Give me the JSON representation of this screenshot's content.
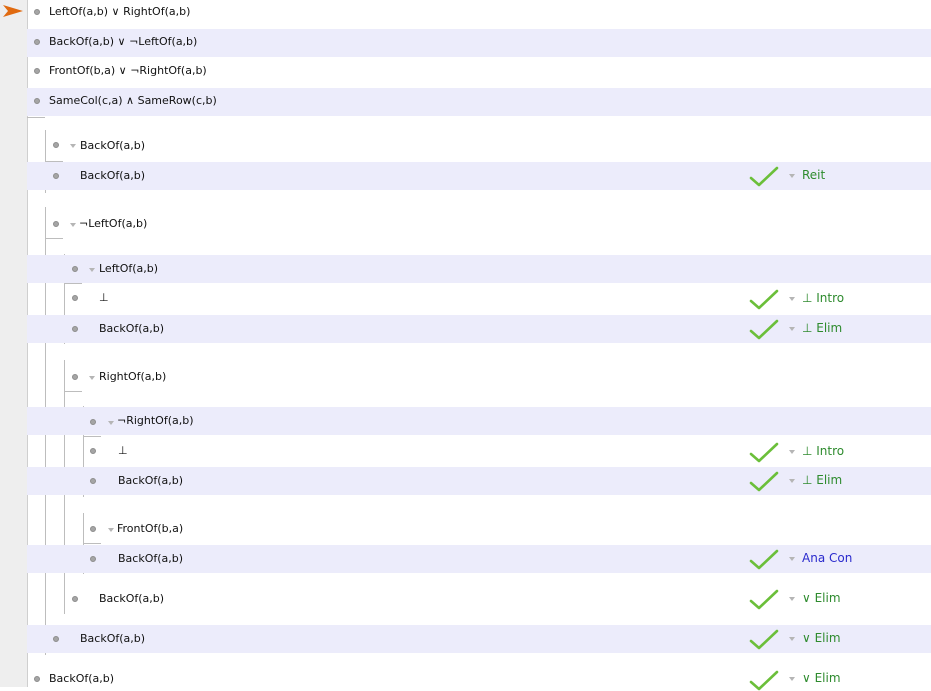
{
  "proof": {
    "premises": [
      "LeftOf(a,b) ∨ RightOf(a,b)",
      "BackOf(a,b) ∨ ¬LeftOf(a,b)",
      "FrontOf(b,a) ∨  ¬RightOf(a,b)",
      "SameCol(c,a) ∧ SameRow(c,b)"
    ],
    "sub1": {
      "assumption": "BackOf(a,b)",
      "step": "BackOf(a,b)",
      "rule": "Reit"
    },
    "sub2": {
      "assumption": "¬LeftOf(a,b)",
      "sub2a": {
        "assumption": "LeftOf(a,b)",
        "step1": "⊥",
        "rule1": "⊥ Intro",
        "step2": "BackOf(a,b)",
        "rule2": "⊥ Elim"
      },
      "sub2b": {
        "assumption": "RightOf(a,b)",
        "sub2b1": {
          "assumption": "¬RightOf(a,b)",
          "step1": "⊥",
          "rule1": "⊥ Intro",
          "step2": "BackOf(a,b)",
          "rule2": "⊥ Elim"
        },
        "sub2b2": {
          "assumption": "FrontOf(b,a)",
          "step": "BackOf(a,b)",
          "rule": "Ana Con"
        },
        "conclusion": "BackOf(a,b)",
        "rule": "∨ Elim"
      },
      "conclusion": "BackOf(a,b)",
      "rule": "∨ Elim"
    },
    "conclusion": "BackOf(a,b)",
    "rule": "∨ Elim"
  },
  "colors": {
    "shade": "#ececfb",
    "check": "#6bbf3a",
    "rule_green": "#2e8b2e",
    "rule_blue": "#2a2acd",
    "pointer": "#e06a10"
  }
}
